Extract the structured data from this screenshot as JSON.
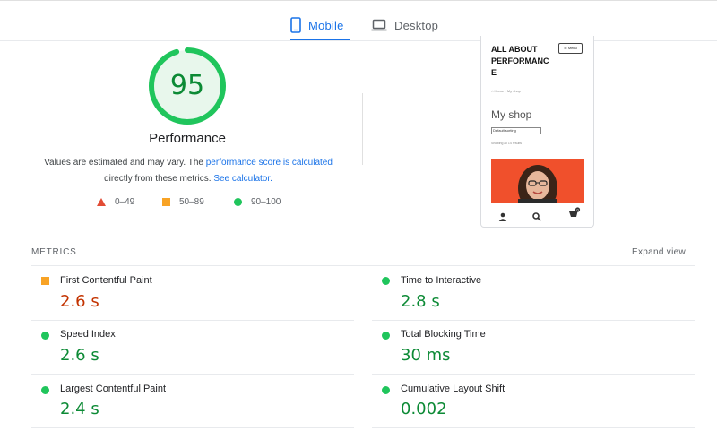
{
  "tabs": [
    {
      "label": "Mobile",
      "active": true,
      "icon": "smartphone-icon"
    },
    {
      "label": "Desktop",
      "active": false,
      "icon": "laptop-icon"
    }
  ],
  "score": {
    "value": "95",
    "title": "Performance",
    "desc_prefix": "Values are estimated and may vary. The ",
    "desc_link": "performance score is calculated",
    "desc_middle": "directly from these metrics. ",
    "desc_link2": "See calculator.",
    "color": "#0c8a35",
    "ring_color": "#20c55c",
    "fill_color": "#e8f7ec"
  },
  "legend": [
    {
      "label": "0–49",
      "shape": "triangle",
      "color": "#e24c35"
    },
    {
      "label": "50–89",
      "shape": "square",
      "color": "#f8a325"
    },
    {
      "label": "90–100",
      "shape": "circle",
      "color": "#20c55c"
    }
  ],
  "preview": {
    "brand": "ALL ABOUT PERFORMANC E",
    "menu_label": "☰ Menu",
    "breadcrumb": "⌂ Home › My shop",
    "heading": "My shop",
    "sort_select": "Default sorting",
    "showing": "Showing all 14 results"
  },
  "metrics": {
    "section_label": "METRICS",
    "expand_label": "Expand view",
    "items": [
      {
        "name": "First Contentful Paint",
        "value": "2.6 s",
        "status": "average"
      },
      {
        "name": "Time to Interactive",
        "value": "2.8 s",
        "status": "good"
      },
      {
        "name": "Speed Index",
        "value": "2.6 s",
        "status": "good"
      },
      {
        "name": "Total Blocking Time",
        "value": "30 ms",
        "status": "good"
      },
      {
        "name": "Largest Contentful Paint",
        "value": "2.4 s",
        "status": "good"
      },
      {
        "name": "Cumulative Layout Shift",
        "value": "0.002",
        "status": "good"
      }
    ]
  }
}
